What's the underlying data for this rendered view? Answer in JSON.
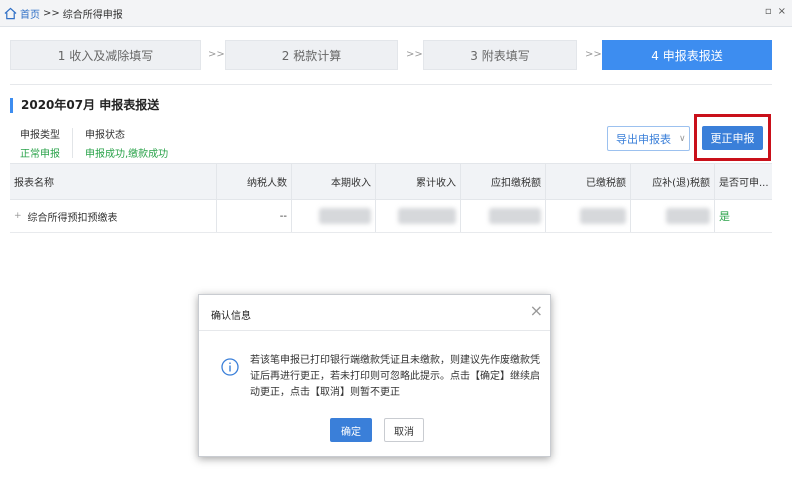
{
  "breadcrumb": {
    "home": "首页",
    "separator": ">>",
    "current": "综合所得申报"
  },
  "window_controls": {
    "restore": "▫",
    "close": "×"
  },
  "steps": [
    {
      "label": "1 收入及减除填写",
      "active": false
    },
    {
      "label": "2 税款计算",
      "active": false
    },
    {
      "label": "3 附表填写",
      "active": false
    },
    {
      "label": "4 申报表报送",
      "active": true
    }
  ],
  "step_separator": ">>",
  "panel": {
    "title": "2020年07月  申报表报送",
    "declare_type_label": "申报类型",
    "declare_type_value": "正常申报",
    "declare_status_label": "申报状态",
    "declare_status_value": "申报成功,缴款成功",
    "export_button": "导出申报表",
    "correct_button": "更正申报"
  },
  "table": {
    "headers": [
      "报表名称",
      "纳税人数",
      "本期收入",
      "累计收入",
      "应扣缴税额",
      "已缴税额",
      "应补(退)税额",
      "是否可申..."
    ],
    "rows": [
      {
        "expand": "+",
        "name": "综合所得预扣预缴表",
        "taxpayers": "--",
        "can_declare": "是"
      }
    ]
  },
  "dialog": {
    "title": "确认信息",
    "message": "若该笔申报已打印银行端缴款凭证且未缴款，则建议先作废缴款凭证后再进行更正，若未打印则可忽略此提示。点击【确定】继续启动更正，点击【取消】则暂不更正",
    "ok": "确定",
    "cancel": "取消"
  },
  "colors": {
    "accent": "#3d8df0",
    "button_blue": "#3a7fd9",
    "success": "#2aa34a",
    "highlight_border": "#c9101a"
  }
}
